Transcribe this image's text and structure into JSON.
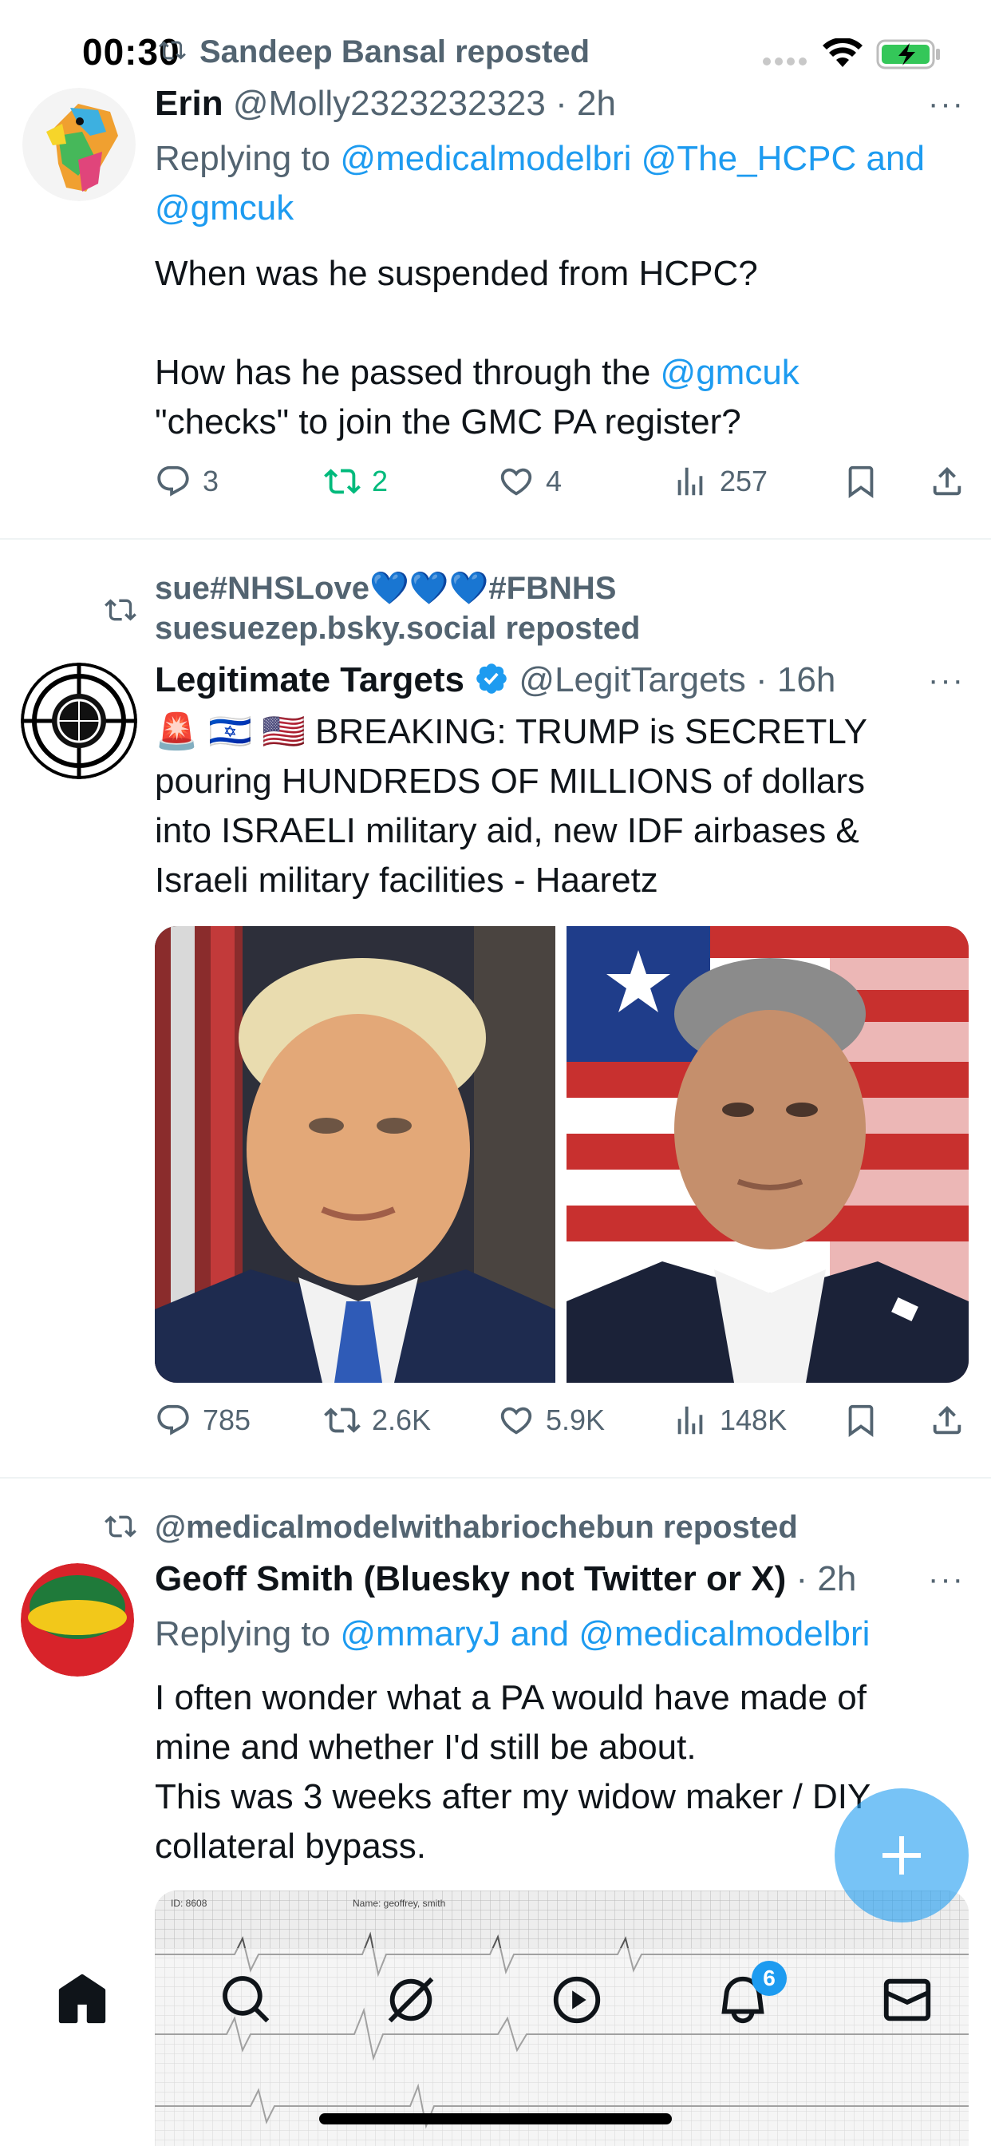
{
  "status_bar": {
    "time": "00:30"
  },
  "tweets": [
    {
      "repost_header": "Sandeep Bansal reposted",
      "display_name": "Erin",
      "handle": "@Molly2323232323",
      "time": "· 2h",
      "reply_prefix": "Replying to",
      "reply_user1": "@medicalmodelbri",
      "reply_user2": "@The_HCPC",
      "reply_and": "and",
      "reply_user3": "@gmcuk",
      "line1": "When was he suspended from HCPC?",
      "line2_a": "How has he passed through the",
      "line2_link": "@gmcuk",
      "line3": "\"checks\" to join the GMC PA register?",
      "replies": "3",
      "reposts": "2",
      "likes": "4",
      "views": "257"
    },
    {
      "repost_header_line1": "sue#NHSLove💙💙💙#FBNHS",
      "repost_header_line2": "suesuezep.bsky.social reposted",
      "display_name": "Legitimate Targets",
      "handle": "@LegitTargets",
      "time": "· 16h",
      "text_line1": "🚨 🇮🇱 🇺🇸 BREAKING: TRUMP is SECRETLY",
      "text_line2": "pouring HUNDREDS OF MILLIONS of dollars",
      "text_line3": "into ISRAELI military aid, new IDF airbases &",
      "text_line4": "Israeli military facilities - Haaretz",
      "replies": "785",
      "reposts": "2.6K",
      "likes": "5.9K",
      "views": "148K"
    },
    {
      "repost_header": "@medicalmodelwithabriochebun reposted",
      "display_name": "Geoff Smith (Bluesky not Twitter or X)",
      "time": "· 2h",
      "reply_prefix": "Replying to",
      "reply_user1": "@mmaryJ",
      "reply_and": "and",
      "reply_user2": "@medicalmodelbri",
      "text_line1": "I often wonder what a PA would have made of",
      "text_line2": "mine and whether I'd still be about.",
      "text_line3": "This was 3 weeks after my widow maker / DIY",
      "text_line4": "collateral bypass.",
      "ecg_id": "ID: 8608",
      "ecg_name": "Name: geoffrey, smith"
    }
  ],
  "nav": {
    "notification_badge": "6"
  },
  "colors": {
    "accent": "#1d9bf0",
    "repost_green": "#00ba7c",
    "text": "#0f1419",
    "muted": "#536471"
  }
}
